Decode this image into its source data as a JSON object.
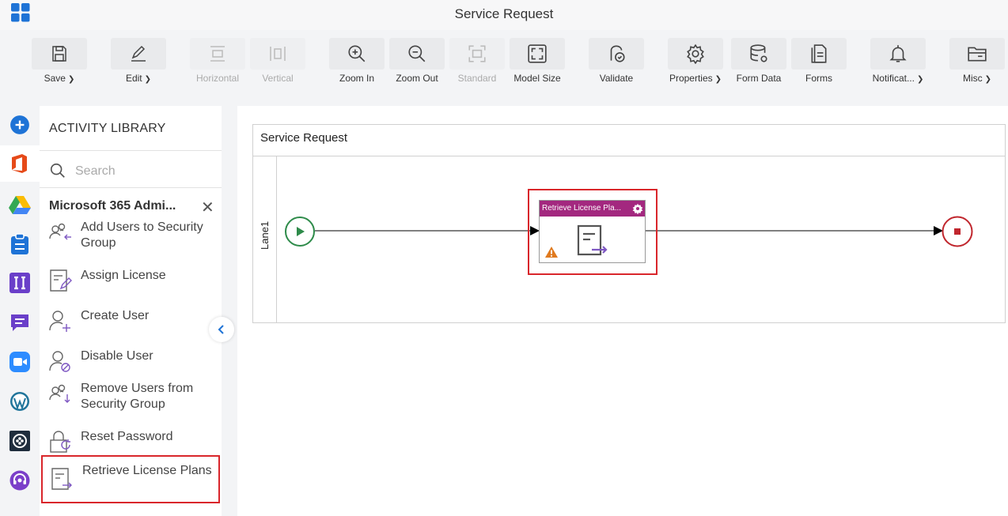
{
  "window": {
    "title": "Service Request"
  },
  "toolbar": {
    "buttons": [
      {
        "label": "Save",
        "icon": "save-icon",
        "dropdown": true,
        "enabled": true
      },
      {
        "label": "Edit",
        "icon": "edit-icon",
        "dropdown": true,
        "enabled": true
      },
      {
        "label": "Horizontal",
        "icon": "horizontal-icon",
        "dropdown": false,
        "enabled": false
      },
      {
        "label": "Vertical",
        "icon": "vertical-icon",
        "dropdown": false,
        "enabled": false
      },
      {
        "label": "Zoom In",
        "icon": "zoom-in-icon",
        "dropdown": false,
        "enabled": true
      },
      {
        "label": "Zoom Out",
        "icon": "zoom-out-icon",
        "dropdown": false,
        "enabled": true
      },
      {
        "label": "Standard",
        "icon": "standard-icon",
        "dropdown": false,
        "enabled": false
      },
      {
        "label": "Model Size",
        "icon": "model-size-icon",
        "dropdown": false,
        "enabled": true
      },
      {
        "label": "Validate",
        "icon": "validate-icon",
        "dropdown": false,
        "enabled": true
      },
      {
        "label": "Properties",
        "icon": "gear-icon",
        "dropdown": true,
        "enabled": true
      },
      {
        "label": "Form Data",
        "icon": "database-icon",
        "dropdown": false,
        "enabled": true
      },
      {
        "label": "Forms",
        "icon": "forms-icon",
        "dropdown": false,
        "enabled": true
      },
      {
        "label": "Notificat...",
        "icon": "bell-icon",
        "dropdown": true,
        "enabled": true
      },
      {
        "label": "Misc",
        "icon": "folder-icon",
        "dropdown": true,
        "enabled": true
      }
    ]
  },
  "rail": {
    "items": [
      {
        "icon": "add-icon",
        "color": "#1e73d6"
      },
      {
        "icon": "office-365-icon",
        "color": "#e64a19",
        "active": true
      },
      {
        "icon": "google-drive-icon",
        "color": "#34a853"
      },
      {
        "icon": "clipboard-icon",
        "color": "#1e73d6"
      },
      {
        "icon": "integration-icon",
        "color": "#6a3fc9"
      },
      {
        "icon": "chat-icon",
        "color": "#6a3fc9"
      },
      {
        "icon": "video-icon",
        "color": "#2d8cff"
      },
      {
        "icon": "wordpress-icon",
        "color": "#21759b"
      },
      {
        "icon": "target-icon",
        "color": "#1f2d3d"
      },
      {
        "icon": "support-icon",
        "color": "#7b3fc9"
      }
    ]
  },
  "library": {
    "title": "ACTIVITY LIBRARY",
    "search_placeholder": "Search",
    "group_title": "Microsoft 365 Admi...",
    "activities": [
      {
        "label": "Add Users to Security Group",
        "icon": "add-users-group-icon"
      },
      {
        "label": "Assign License",
        "icon": "assign-license-icon"
      },
      {
        "label": "Create User",
        "icon": "create-user-icon"
      },
      {
        "label": "Disable User",
        "icon": "disable-user-icon"
      },
      {
        "label": "Remove Users from Security Group",
        "icon": "remove-users-group-icon"
      },
      {
        "label": "Reset Password",
        "icon": "reset-password-icon"
      },
      {
        "label": "Retrieve License Plans",
        "icon": "retrieve-license-icon",
        "selected": true
      }
    ]
  },
  "canvas": {
    "pool_title": "Service Request",
    "lane_label": "Lane1",
    "task": {
      "title": "Retrieve License Pla...",
      "header_color": "#a3287f",
      "has_warning": true
    },
    "start_color": "#2e8b4a",
    "end_color": "#c0262d"
  },
  "colors": {
    "selection": "#d9262b",
    "accent": "#1e73d6"
  }
}
